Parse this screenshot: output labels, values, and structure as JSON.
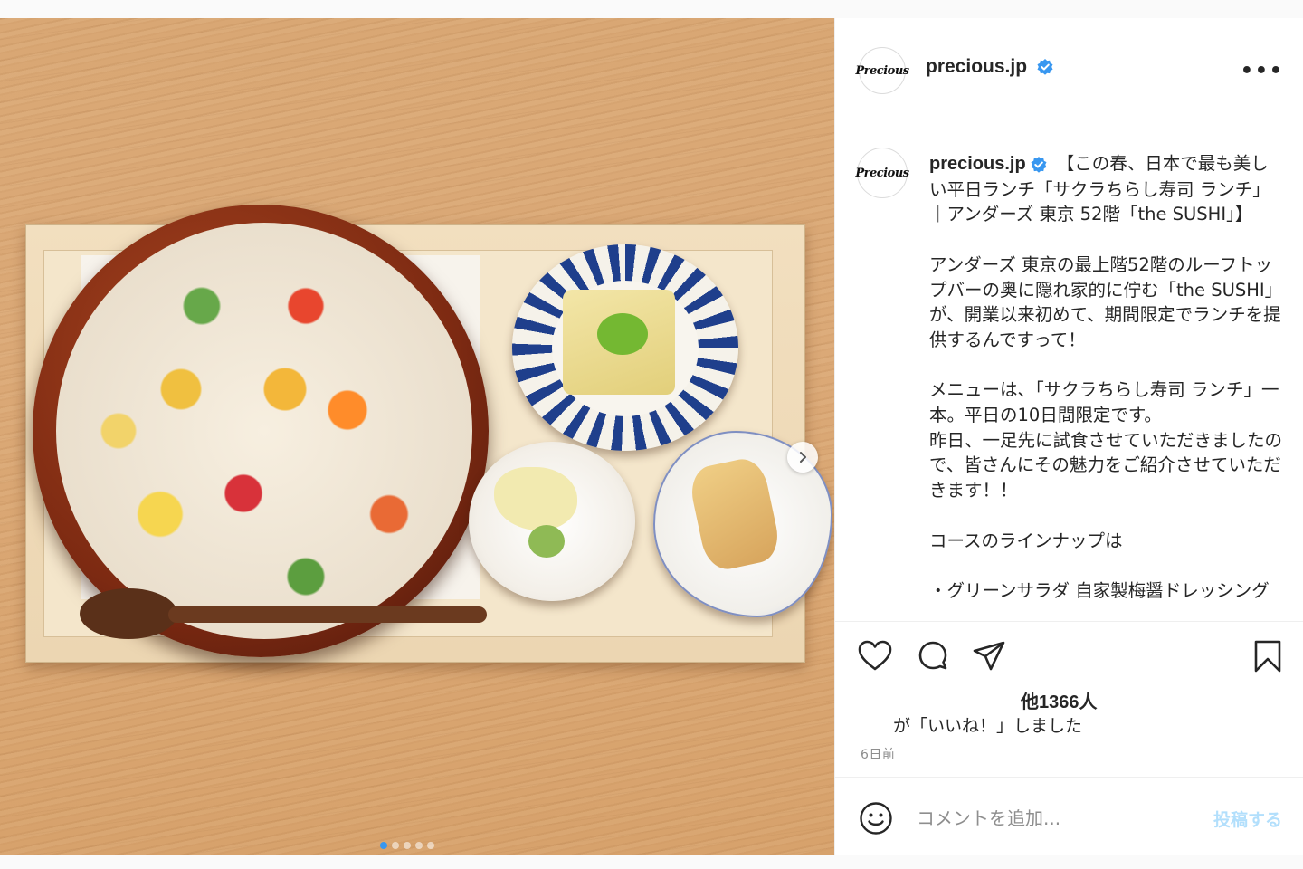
{
  "post": {
    "username": "precious.jp",
    "avatar_text": "Precious",
    "verified_icon": "verified-badge-icon",
    "more_icon": "more-options-icon",
    "accent": "#3897f0",
    "caption_text": "【この春、日本で最も美しい平日ランチ「サクラちらし寿司 ランチ」｜アンダーズ 東京 52階「the SUSHI」】\n\nアンダーズ 東京の最上階52階のルーフトップバーの奥に隠れ家的に佇む「the SUSHI」が、開業以来初めて、期間限定でランチを提供するんですって！\n\nメニューは、「サクラちらし寿司 ランチ」一本。平日の10日間限定です。\n昨日、一足先に試食させていただきましたので、皆さんにその魅力をご紹介させていただきます！！\n\nコースのラインナップは\n\n・グリーンサラダ 自家製梅醤ドレッシング",
    "likes_count": "他1366人",
    "likes_suffix": "が「いいね！」しました",
    "time_ago": "6日前"
  },
  "actions": {
    "like_icon": "heart-icon",
    "comment_icon": "comment-icon",
    "share_icon": "paper-plane-icon",
    "save_icon": "bookmark-icon"
  },
  "comment_bar": {
    "emoji_icon": "smiley-icon",
    "placeholder": "コメントを追加...",
    "post_label": "投稿する"
  },
  "carousel": {
    "slide_count": 5,
    "active_index": 0,
    "next_icon": "chevron-right-icon"
  }
}
